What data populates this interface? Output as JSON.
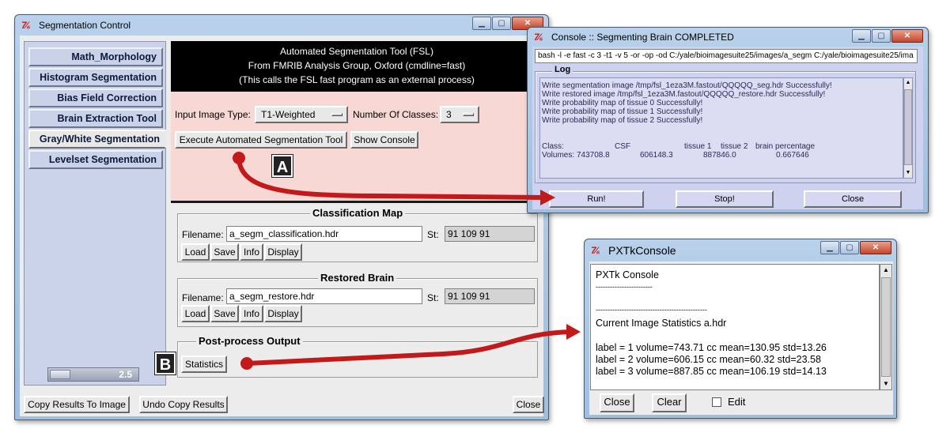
{
  "seg": {
    "title": "Segmentation Control",
    "tabs": [
      "Math_Morphology",
      "Histogram Segmentation",
      "Bias Field Correction",
      "Brain Extraction Tool",
      "Gray/White Segmentation",
      "Levelset Segmentation"
    ],
    "header": [
      "Automated Segmentation Tool (FSL)",
      "From FMRIB Analysis Group, Oxford (cmdline=fast)",
      "(This calls the FSL fast program as an external process)"
    ],
    "input_type_label": "Input Image Type:",
    "input_type_value": "T1-Weighted",
    "num_classes_label": "Number Of Classes:",
    "num_classes_value": "3",
    "execute_label": "Execute Automated Segmentation Tool",
    "show_console_label": "Show Console",
    "classification": {
      "title": "Classification Map",
      "filename_label": "Filename:",
      "filename": "a_segm_classification.hdr",
      "st_label": "St:",
      "st_value": "91 109 91"
    },
    "restored": {
      "title": "Restored Brain",
      "filename_label": "Filename:",
      "filename": "a_segm_restore.hdr",
      "st_label": "St:",
      "st_value": "91 109 91"
    },
    "file_buttons": [
      "Load",
      "Save",
      "Info",
      "Display"
    ],
    "postprocess_title": "Post-process Output",
    "statistics_label": "Statistics",
    "slider_value": "2.5",
    "copy_results_label": "Copy Results To Image",
    "undo_copy_label": "Undo Copy Results",
    "close_label": "Close"
  },
  "console": {
    "title": "Console :: Segmenting Brain COMPLETED",
    "command": "bash -l -e fast -c 3 -t1 -v 5 -or -op -od C:/yale/bioimagesuite25/images/a_segm C:/yale/bioimagesuite25/ima",
    "log_title": "Log",
    "log_lines": [
      "Write segmentation image /tmp/fsl_1eza3M.fastout/QQQQQ_seg.hdr Successfully!",
      "Write restored image /tmp/fsl_1eza3M.fastout/QQQQQ_restore.hdr Successfully!",
      "Write probability map of tissue 0 Successfully!",
      "Write probability map of tissue 1 Successfully!",
      "Write probability map of tissue 2 Successfully!"
    ],
    "class_row": [
      "Class:",
      "CSF",
      "tissue 1",
      "tissue 2",
      "brain percentage"
    ],
    "volumes_row": [
      "Volumes:",
      "743708.8",
      "606148.3",
      "887846.0",
      "0.667646"
    ],
    "run_label": "Run!",
    "stop_label": "Stop!",
    "close_label": "Close"
  },
  "pxtk": {
    "title": "PXTkConsole",
    "heading": "PXTk Console",
    "dash_short": "------------------------",
    "dash_long": "-----------------------------------------------",
    "stats_title": "Current Image Statistics a.hdr",
    "stats": [
      "label = 1  volume=743.71 cc  mean=130.95  std=13.26",
      "label = 2  volume=606.15 cc  mean=60.32  std=23.58",
      "label = 3  volume=887.85 cc  mean=106.19  std=14.13"
    ],
    "close_label": "Close",
    "clear_label": "Clear",
    "edit_label": "Edit"
  },
  "callouts": {
    "a": "A",
    "b": "B"
  },
  "colors": {
    "arrow": "#c21a1a",
    "header_bg": "#000000",
    "top_panel": "#f7d8d4",
    "sidebar": "#cbd3ea"
  }
}
